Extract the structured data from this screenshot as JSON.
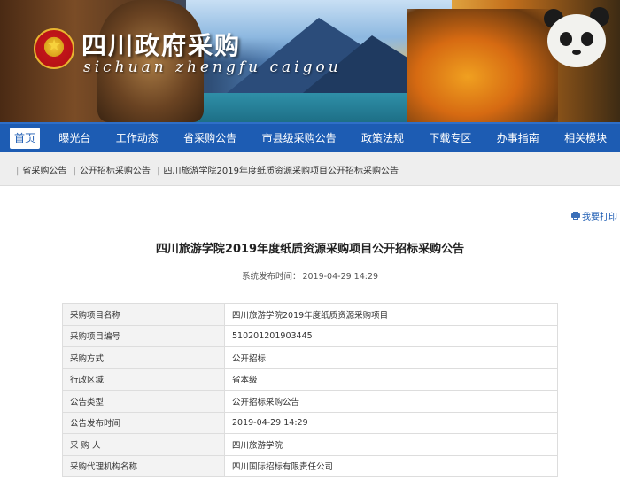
{
  "banner": {
    "title": "四川政府采购",
    "subtitle": "sichuan zhengfu caigou"
  },
  "nav": {
    "items": [
      "首页",
      "曝光台",
      "工作动态",
      "省采购公告",
      "市县级采购公告",
      "政策法规",
      "下载专区",
      "办事指南",
      "相关模块"
    ],
    "active_index": 0
  },
  "breadcrumb": {
    "items": [
      "省采购公告",
      "公开招标采购公告",
      "四川旅游学院2019年度纸质资源采购项目公开招标采购公告"
    ]
  },
  "print_label": "我要打印",
  "document": {
    "title": "四川旅游学院2019年度纸质资源采购项目公开招标采购公告",
    "publish_label": "系统发布时间：",
    "publish_time": "2019-04-29 14:29"
  },
  "info_rows": [
    {
      "key": "采购项目名称",
      "value": "四川旅游学院2019年度纸质资源采购项目"
    },
    {
      "key": "采购项目编号",
      "value": "510201201903445"
    },
    {
      "key": "采购方式",
      "value": "公开招标"
    },
    {
      "key": "行政区域",
      "value": "省本级"
    },
    {
      "key": "公告类型",
      "value": "公开招标采购公告"
    },
    {
      "key": "公告发布时间",
      "value": "2019-04-29 14:29"
    },
    {
      "key": "采 购 人",
      "value": "四川旅游学院"
    },
    {
      "key": "采购代理机构名称",
      "value": "四川国际招标有限责任公司"
    }
  ],
  "colors": {
    "nav_bg": "#1d5cb3",
    "breadcrumb_bg": "#eeeeee",
    "table_key_bg": "#f3f3f3"
  },
  "icons": {
    "emblem": "national-emblem-icon",
    "print": "printer-icon"
  }
}
